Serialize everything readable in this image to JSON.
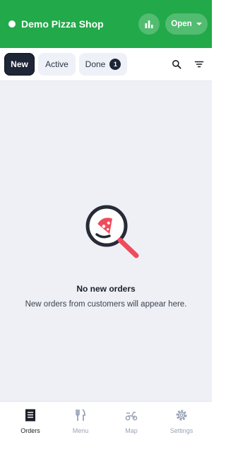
{
  "header": {
    "shop_name": "Demo Pizza Shop",
    "status_label": "Open",
    "brand_color": "#22a94a",
    "icons": [
      "stats-icon",
      "chevron-down-icon"
    ]
  },
  "tabs": {
    "items": [
      {
        "label": "New",
        "selected": true
      },
      {
        "label": "Active",
        "selected": false
      },
      {
        "label": "Done",
        "selected": false,
        "badge": "1"
      }
    ],
    "icons": [
      "search-icon",
      "filter-icon"
    ]
  },
  "empty_state": {
    "title": "No new orders",
    "subtitle": "New orders from customers will appear here.",
    "illustration": "magnifier-pizza-icon"
  },
  "bottom_nav": {
    "items": [
      {
        "label": "Orders",
        "icon": "orders-icon",
        "selected": true
      },
      {
        "label": "Menu",
        "icon": "utensils-icon",
        "selected": false
      },
      {
        "label": "Map",
        "icon": "scooter-icon",
        "selected": false
      },
      {
        "label": "Settings",
        "icon": "gear-icon",
        "selected": false
      }
    ]
  }
}
